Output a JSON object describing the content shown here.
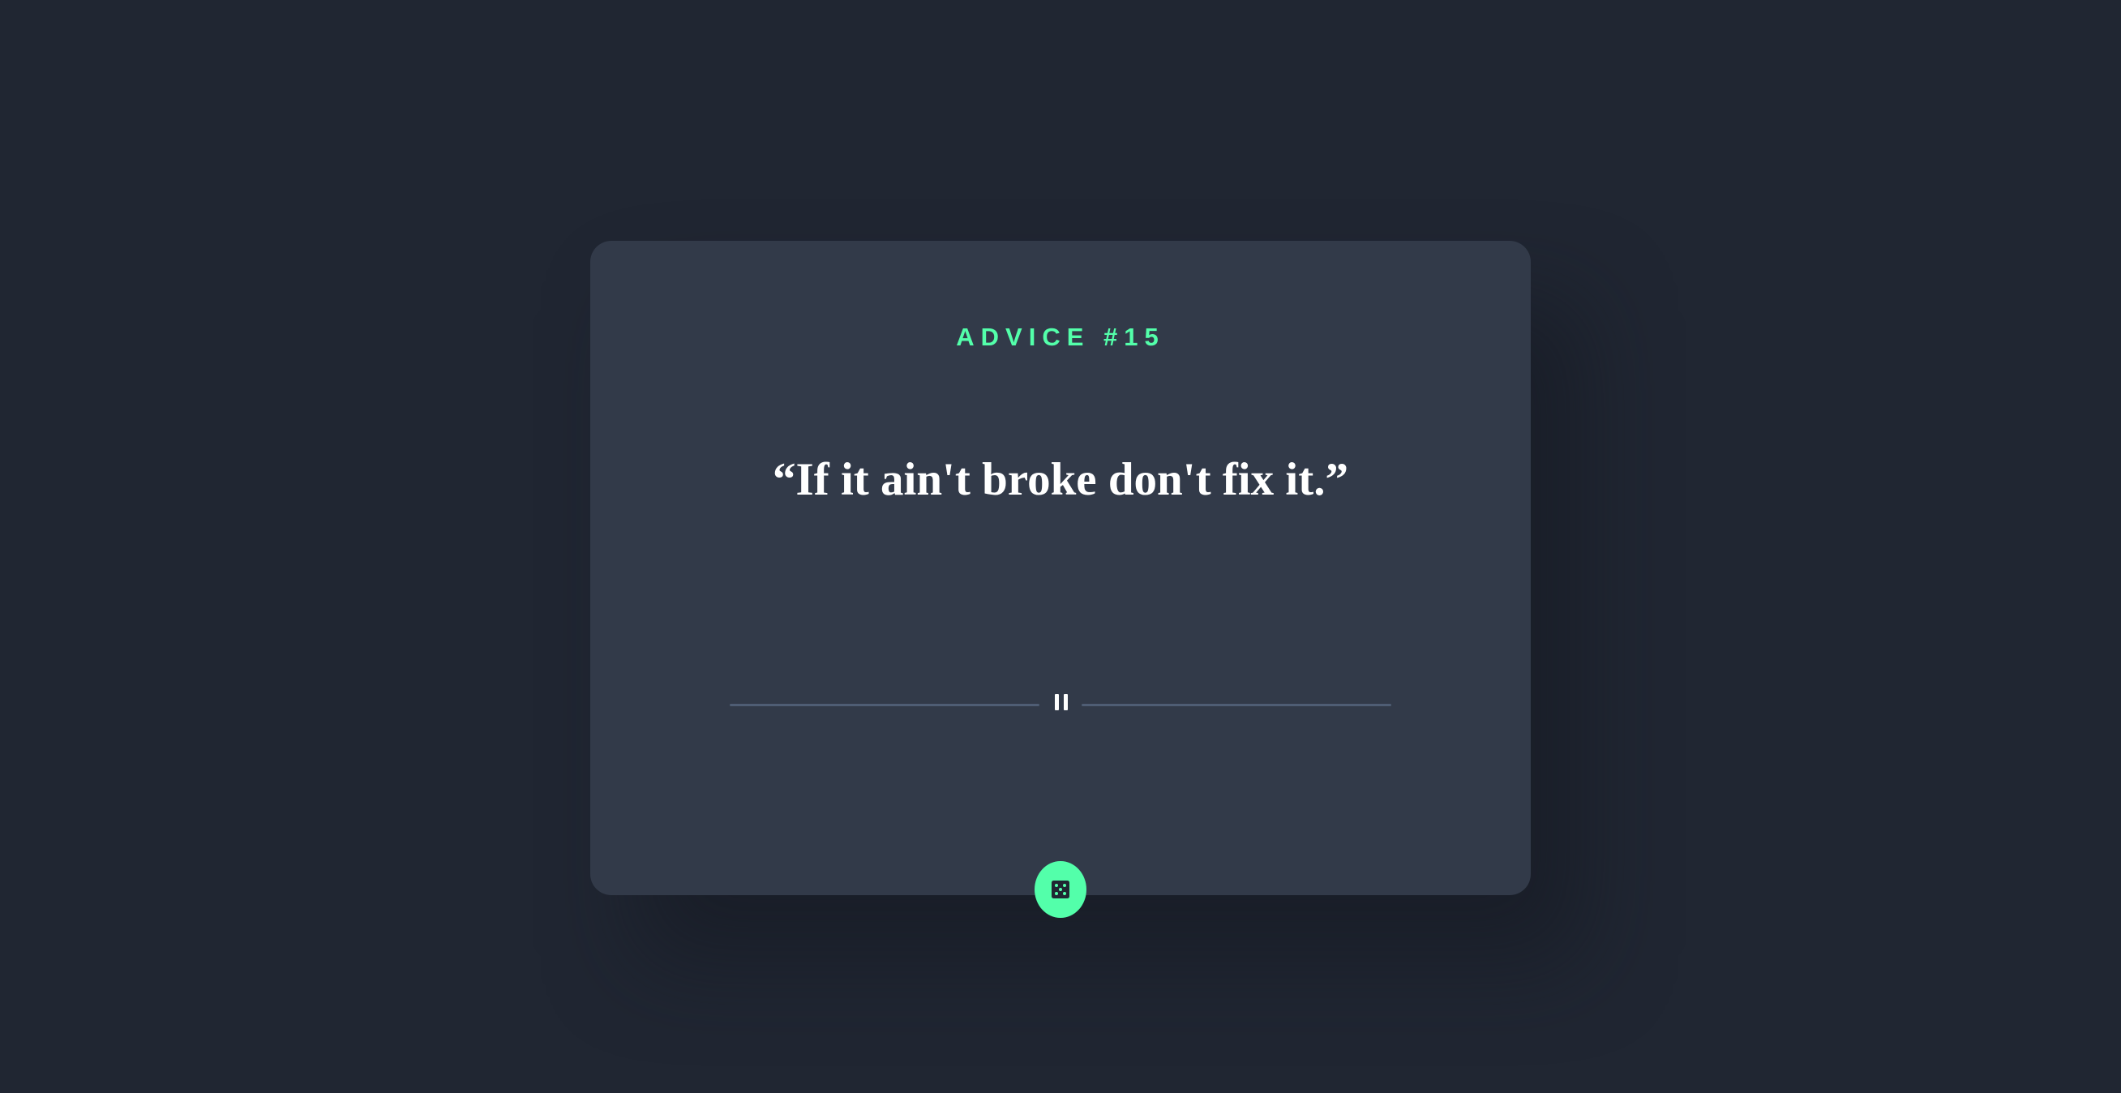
{
  "advice": {
    "label": "ADVICE #15",
    "quote": "“If it ain't broke don't fix it.”"
  },
  "colors": {
    "background": "#202632",
    "card": "#323a49",
    "accent": "#53ffaa",
    "quote_text": "#ffffff",
    "divider": "#4f5d74"
  },
  "icons": {
    "divider_icon": "pause-icon",
    "button_icon": "dice-icon"
  }
}
